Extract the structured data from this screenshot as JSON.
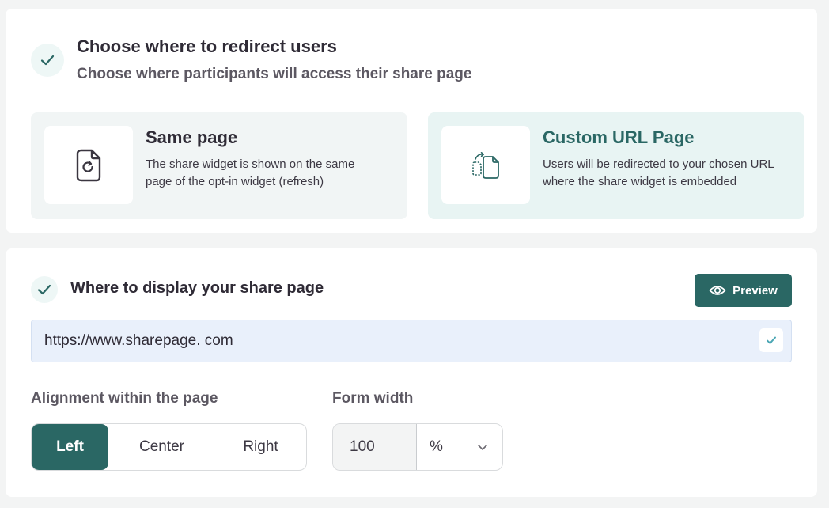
{
  "redirect": {
    "title": "Choose where to redirect users",
    "subtitle": "Choose where participants will access their share page",
    "options": [
      {
        "title": "Same page",
        "description": "The share widget is shown on the same page of the opt-in widget (refresh)",
        "icon": "refresh-file-icon",
        "selected": false
      },
      {
        "title": "Custom URL Page",
        "description": "Users will be redirected to your chosen URL where the share widget is embedded",
        "icon": "copy-pages-icon",
        "selected": true
      }
    ]
  },
  "display": {
    "title": "Where to display your share page",
    "preview_label": "Preview",
    "url_value": "https://www.sharepage. com",
    "alignment_label": "Alignment within the page",
    "alignment_options": [
      "Left",
      "Center",
      "Right"
    ],
    "alignment_selected": "Left",
    "width_label": "Form width",
    "width_value": "100",
    "width_unit": "%"
  },
  "colors": {
    "accent": "#2a6764",
    "badge_bg": "#eef7f6",
    "selected_option_bg": "#e8f4f3",
    "url_bg": "#e9f0fb"
  }
}
